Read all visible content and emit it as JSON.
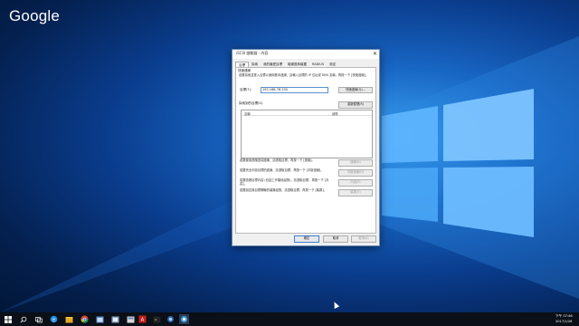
{
  "desktop": {
    "brand_text": "Google",
    "colors": {
      "wallpaper_bright": "#3aa0ee",
      "wallpaper_dark": "#021533",
      "taskbar": "#0b0f17"
    }
  },
  "dialog": {
    "title": "iSCSI 啟動器 - 內容",
    "tabs": [
      "目標",
      "探索",
      "我的最愛目標",
      "磁碟區和裝置",
      "RADIUS",
      "設定"
    ],
    "quick_connect": {
      "title": "快速連線",
      "description": "若要探索並登入目標以使用基本連線，請輸入目標的 IP 位址或 DNS 名稱，再按一下 [快速連線]。",
      "target_label": "目標(T):",
      "target_value": "192.168.78.130",
      "quick_connect_button": "快速連線(Q)..."
    },
    "discovered": {
      "title": "探索到的目標(G)",
      "refresh_button": "重新整理(R)",
      "columns": [
        "名稱",
        "狀態"
      ]
    },
    "actions": [
      {
        "text": "若要使用進階選項連線，請選取目標，再按一下 [連線]。",
        "button": "連線(N)"
      },
      {
        "text": "若要完全中斷目標的連線，請選取目標，再按一下 [中斷連線]。",
        "button": "中斷連線(D)"
      },
      {
        "text": "若要查看目標內容 (包括工作階段組態)，請選取目標，再按一下 [內容]。",
        "button": "內容(P)"
      },
      {
        "text": "若要設定與目標關聯的裝置組態，請選取目標，再按一下 [裝置]。",
        "button": "裝置(V)"
      }
    ],
    "footer": {
      "ok": "確定",
      "cancel": "取消",
      "apply": "套用(A)"
    }
  },
  "taskbar": {
    "icons": [
      "windows-start-icon",
      "search-icon",
      "task-view-icon",
      "edge-icon",
      "file-explorer-icon",
      "chrome-icon",
      "control-panel-icon",
      "app-icon",
      "acrobat-icon",
      "terminal-icon",
      "network-icon",
      "iscsi-icon"
    ],
    "time": "下午 07:46",
    "date": "2017/1/26"
  }
}
